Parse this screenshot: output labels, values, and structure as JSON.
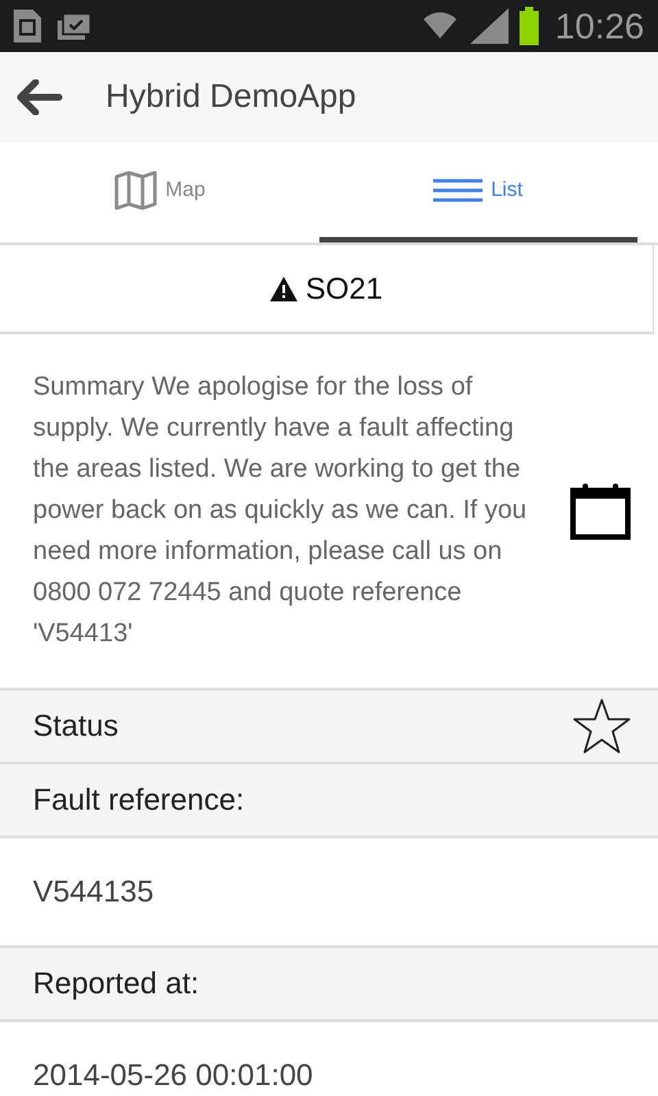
{
  "status_bar": {
    "time": "10:26"
  },
  "app_bar": {
    "title": "Hybrid DemoApp"
  },
  "tabs": [
    {
      "label": "Map",
      "kind": "map",
      "selected": false
    },
    {
      "label": "List",
      "kind": "list",
      "selected": true
    }
  ],
  "heading": {
    "title": "SO21"
  },
  "summary": {
    "text": "Summary We apologise for the loss of supply. We currently have a fault affecting the areas listed. We are working to get the power back on as quickly as we can. If you need more information, please call us on 0800 072 72445 and quote reference 'V54413'"
  },
  "rows": [
    {
      "kind": "starred",
      "text": "Status"
    },
    {
      "kind": "label",
      "text": "Fault reference:"
    },
    {
      "kind": "value",
      "text": "V544135"
    },
    {
      "kind": "label",
      "text": "Reported at:"
    },
    {
      "kind": "value",
      "text": "2014-05-26 00:01:00"
    }
  ]
}
